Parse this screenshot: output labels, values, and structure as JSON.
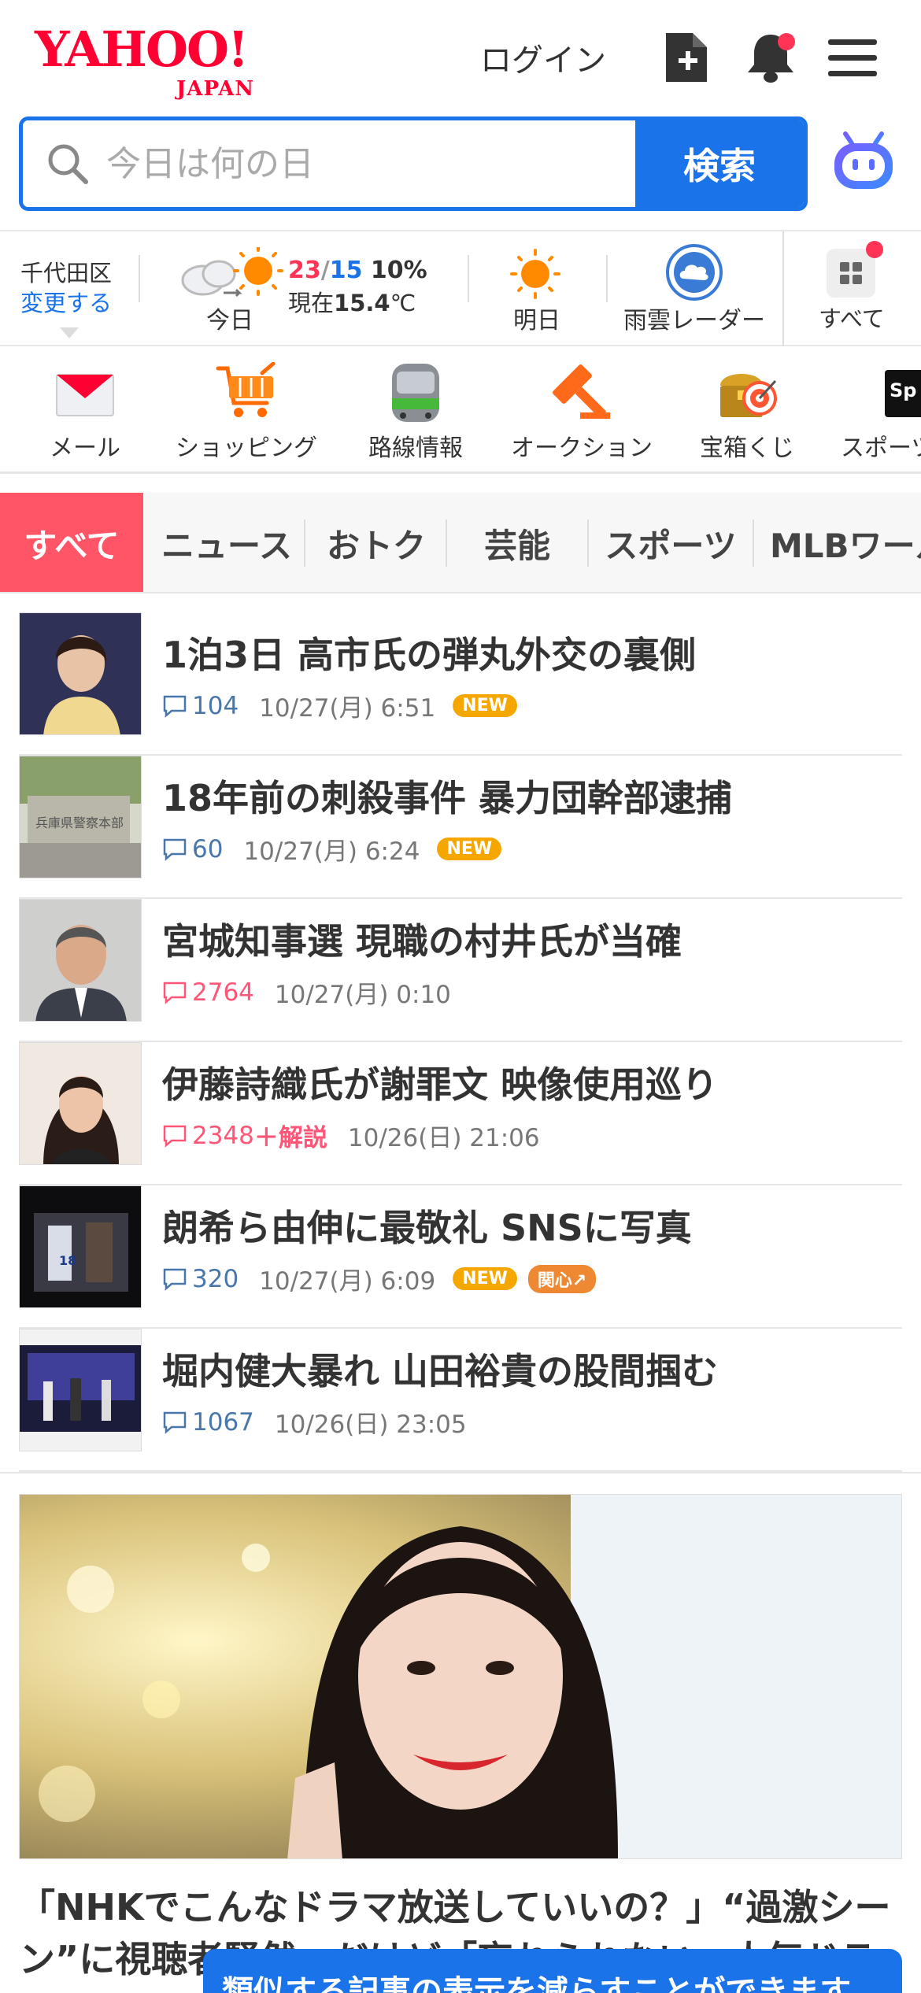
{
  "header": {
    "logo_text": "YAHOO!",
    "logo_sub": "JAPAN",
    "login_label": "ログイン"
  },
  "search": {
    "placeholder": "今日は何の日",
    "button_label": "検索"
  },
  "weather": {
    "location": "千代田区",
    "change_label": "変更する",
    "today_label": "今日",
    "high": "23",
    "slash": "/",
    "low": "15",
    "precip": "10%",
    "now_prefix": "現在",
    "now_temp": "15.4",
    "now_unit": "℃",
    "tomorrow_label": "明日",
    "radar_label": "雨雲レーダー",
    "all_label": "すべて"
  },
  "services": [
    {
      "label": "メール",
      "icon": "mail-icon"
    },
    {
      "label": "ショッピング",
      "icon": "cart-icon"
    },
    {
      "label": "路線情報",
      "icon": "train-icon"
    },
    {
      "label": "オークション",
      "icon": "gavel-icon"
    },
    {
      "label": "宝箱くじ",
      "icon": "treasure-icon"
    },
    {
      "label": "スポーツ",
      "icon": "sports-icon"
    }
  ],
  "tabs": [
    "すべて",
    "ニュース",
    "おトク",
    "芸能",
    "スポーツ",
    "MLBワールド"
  ],
  "news": [
    {
      "title": "1泊3日 高市氏の弾丸外交の裏側",
      "comments": "104",
      "date": "10/27(月) 6:51",
      "new": "NEW",
      "hot": false
    },
    {
      "title": "18年前の刺殺事件 暴力団幹部逮捕",
      "comments": "60",
      "date": "10/27(月) 6:24",
      "new": "NEW",
      "hot": false
    },
    {
      "title": "宮城知事選 現職の村井氏が当確",
      "comments": "2764",
      "date": "10/27(月) 0:10",
      "hot": true
    },
    {
      "title": "伊藤詩織氏が謝罪文 映像使用巡り",
      "comments": "2348",
      "extra": "＋解説",
      "date": "10/26(日) 21:06",
      "hot": true
    },
    {
      "title": "朗希ら由伸に最敬礼 SNSに写真",
      "comments": "320",
      "date": "10/27(月) 6:09",
      "new": "NEW",
      "kanshin": "関心↗",
      "hot": false
    },
    {
      "title": "堀内健大暴れ 山田裕貴の股間掴む",
      "comments": "1067",
      "date": "10/26(日) 23:05",
      "hot": false
    }
  ],
  "featured": {
    "title": "「NHKでこんなドラマ放送していいの？」“過激シーン”に視聴者騒然…だけど「忘れられない」人気ドラマ"
  },
  "toast": {
    "text": "類似する記事の表示を減らすことができます"
  }
}
